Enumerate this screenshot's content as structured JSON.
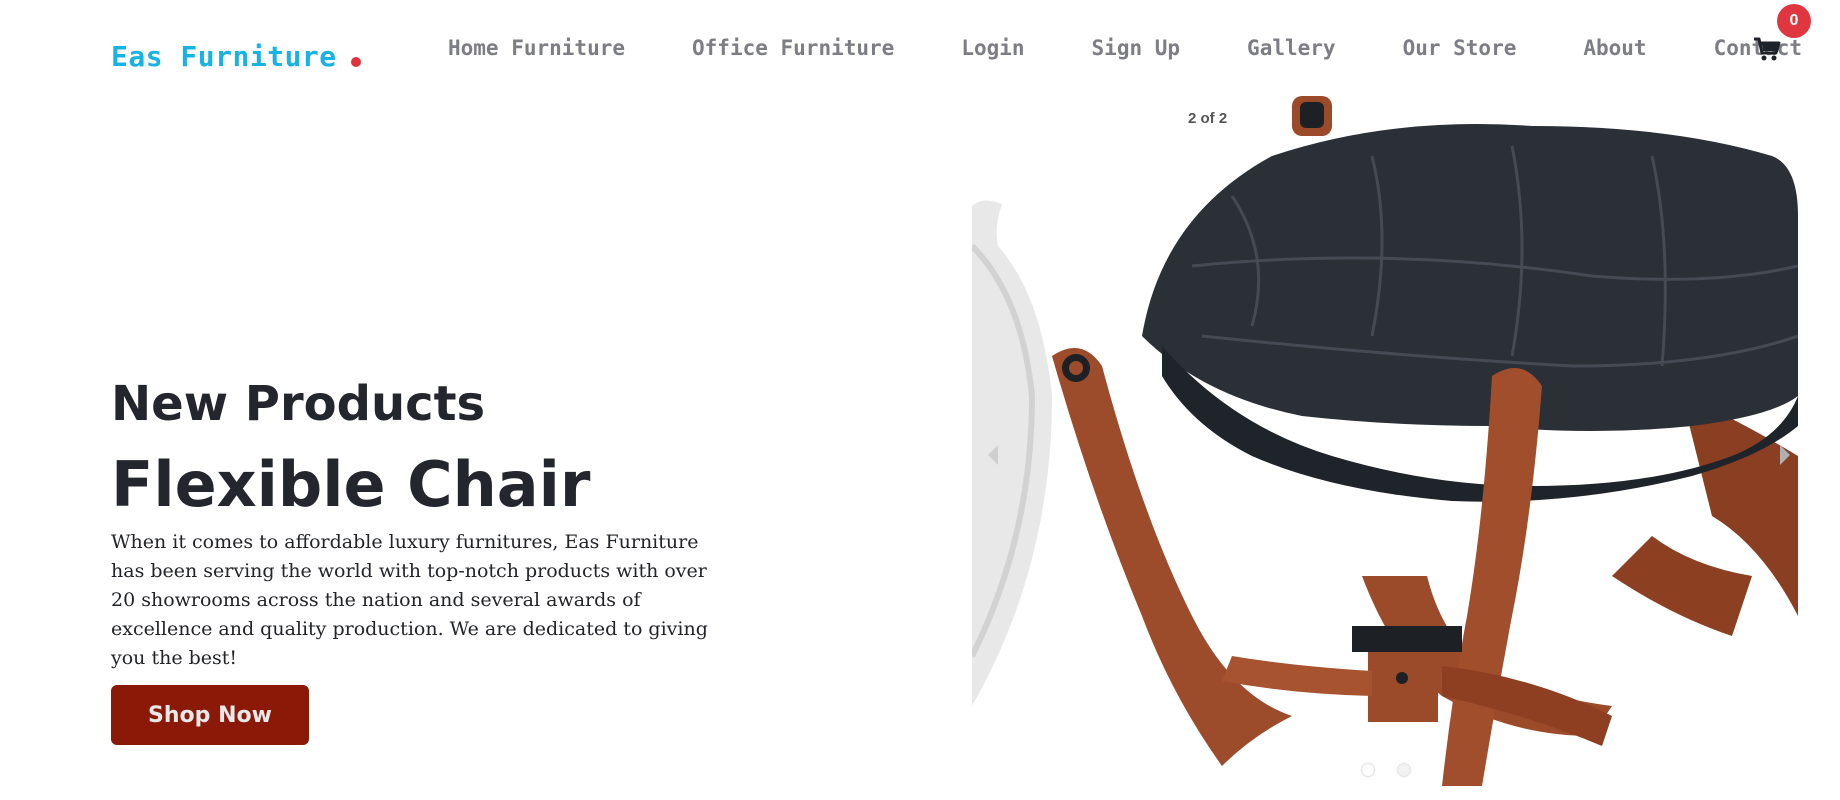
{
  "brand": {
    "name": "Eas Furniture"
  },
  "nav": {
    "items": [
      {
        "label": "Home Furniture"
      },
      {
        "label": "Office Furniture"
      },
      {
        "label": "Login"
      },
      {
        "label": "Sign Up"
      },
      {
        "label": "Gallery"
      },
      {
        "label": "Our Store"
      },
      {
        "label": "About"
      },
      {
        "label": "Contact"
      }
    ]
  },
  "cart": {
    "icon": "shopping-cart-icon",
    "count": "0"
  },
  "hero": {
    "eyebrow": "New Products",
    "title": "Flexible Chair",
    "description": "When it comes to affordable luxury furnitures, Eas Furniture has been serving the world with top-notch products with over 20 showrooms across the nation and several awards of excellence and quality production. We are dedicated to giving you the best!",
    "cta_label": "Shop Now"
  },
  "carousel": {
    "counter": "2 of 2",
    "slide_count": 2,
    "active_index": 1,
    "product_image": "black-leather-chair-wooden-frame"
  },
  "colors": {
    "brand_blue": "#17b3e4",
    "accent_red": "#e0313c",
    "cta_bg": "#8a1a07",
    "nav_text": "#7d7d86",
    "heading": "#23262d"
  }
}
